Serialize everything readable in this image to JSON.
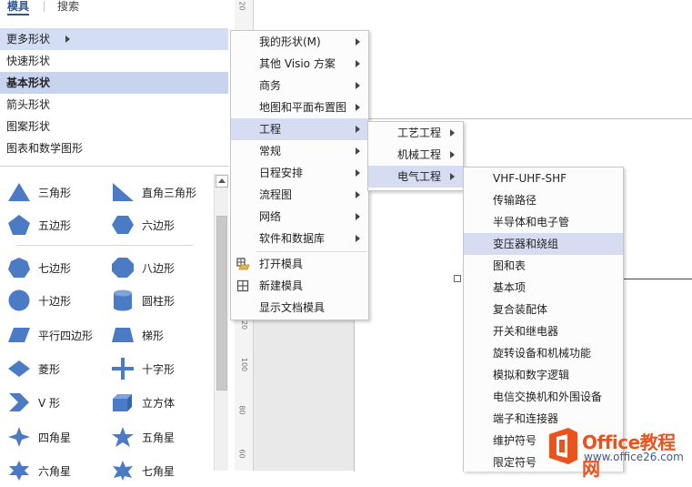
{
  "tabs": {
    "stencils": "模具",
    "search": "搜索"
  },
  "stencil_list": [
    {
      "label": "更多形状",
      "state": "highlight",
      "has_arrow": true
    },
    {
      "label": "快速形状",
      "state": "normal"
    },
    {
      "label": "基本形状",
      "state": "active"
    },
    {
      "label": "箭头形状",
      "state": "normal"
    },
    {
      "label": "图案形状",
      "state": "normal"
    },
    {
      "label": "图表和数学图形",
      "state": "normal"
    }
  ],
  "shapes": [
    {
      "label": "三角形",
      "icon": "triangle-shape-icon"
    },
    {
      "label": "直角三角形",
      "icon": "right-triangle-shape-icon"
    },
    {
      "label": "五边形",
      "icon": "pentagon-shape-icon"
    },
    {
      "label": "六边形",
      "icon": "hexagon-shape-icon"
    },
    {
      "label": "七边形",
      "icon": "heptagon-shape-icon"
    },
    {
      "label": "八边形",
      "icon": "octagon-shape-icon"
    },
    {
      "label": "十边形",
      "icon": "decagon-shape-icon"
    },
    {
      "label": "圆柱形",
      "icon": "cylinder-shape-icon"
    },
    {
      "label": "平行四边形",
      "icon": "parallelogram-shape-icon"
    },
    {
      "label": "梯形",
      "icon": "trapezoid-shape-icon"
    },
    {
      "label": "菱形",
      "icon": "diamond-shape-icon"
    },
    {
      "label": "十字形",
      "icon": "cross-shape-icon"
    },
    {
      "label": "V 形",
      "icon": "chevron-shape-icon"
    },
    {
      "label": "立方体",
      "icon": "cube-shape-icon"
    },
    {
      "label": "四角星",
      "icon": "four-point-star-icon"
    },
    {
      "label": "五角星",
      "icon": "five-point-star-icon"
    },
    {
      "label": "六角星",
      "icon": "six-point-star-icon"
    },
    {
      "label": "七角星",
      "icon": "seven-point-star-icon"
    }
  ],
  "ruler": {
    "ticks": [
      "20",
      "120",
      "100",
      "80",
      "60"
    ]
  },
  "menu_more_shapes": [
    {
      "label": "我的形状(M)",
      "arrow": true
    },
    {
      "label": "其他 Visio 方案",
      "arrow": true
    },
    {
      "label": "商务",
      "arrow": true
    },
    {
      "label": "地图和平面布置图",
      "arrow": true
    },
    {
      "label": "工程",
      "arrow": true,
      "highlight": true
    },
    {
      "label": "常规",
      "arrow": true
    },
    {
      "label": "日程安排",
      "arrow": true
    },
    {
      "label": "流程图",
      "arrow": true
    },
    {
      "label": "网络",
      "arrow": true
    },
    {
      "label": "软件和数据库",
      "arrow": true
    },
    {
      "label": "打开模具",
      "icon": "open-stencil-icon"
    },
    {
      "label": "新建模具",
      "icon": "new-stencil-icon"
    },
    {
      "label": "显示文档模具"
    }
  ],
  "menu_engineering": [
    {
      "label": "工艺工程",
      "arrow": true
    },
    {
      "label": "机械工程",
      "arrow": true
    },
    {
      "label": "电气工程",
      "arrow": true,
      "highlight": true
    }
  ],
  "menu_electrical": [
    {
      "label": "VHF-UHF-SHF"
    },
    {
      "label": "传输路径"
    },
    {
      "label": "半导体和电子管"
    },
    {
      "label": "变压器和绕组",
      "highlight": true
    },
    {
      "label": "图和表"
    },
    {
      "label": "基本项"
    },
    {
      "label": "复合装配体"
    },
    {
      "label": "开关和继电器"
    },
    {
      "label": "旋转设备和机械功能"
    },
    {
      "label": "模拟和数字逻辑"
    },
    {
      "label": "电信交换机和外围设备"
    },
    {
      "label": "端子和连接器"
    },
    {
      "label": "维护符号"
    },
    {
      "label": "限定符号"
    }
  ],
  "watermark": {
    "title": "Office教程网",
    "url": "www.office26.com"
  },
  "colors": {
    "accent": "#2b579a",
    "shape_fill": "#4a7bc4",
    "menu_highlight": "#d6dcf2",
    "watermark": "#e8531e"
  }
}
